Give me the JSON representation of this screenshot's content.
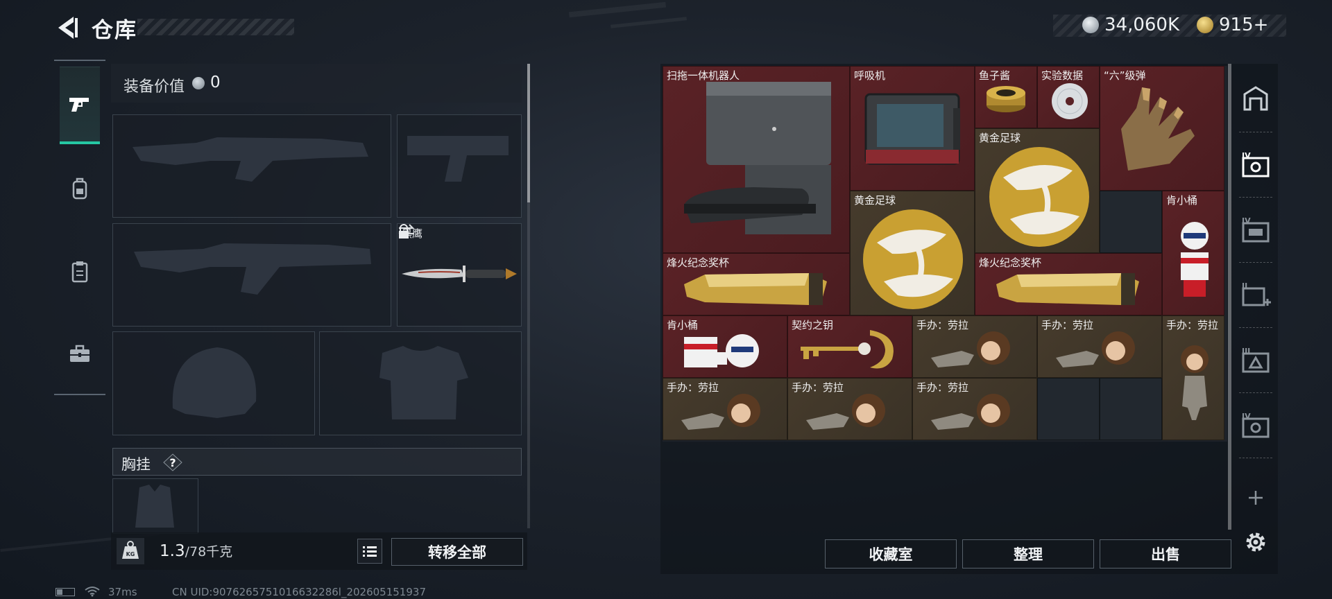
{
  "header": {
    "title": "仓库",
    "back_icon": "back-arrow-icon",
    "currencies": [
      {
        "icon": "silver-coin-icon",
        "value": "34,060K",
        "color": "#c9d0d6"
      },
      {
        "icon": "gold-triangle-coin-icon",
        "value": "915+",
        "color": "#d8b24a"
      }
    ]
  },
  "left_rail": {
    "tabs": [
      {
        "icon": "pistol-icon",
        "active": true
      },
      {
        "icon": "backpack-icon",
        "active": false
      },
      {
        "icon": "clipboard-icon",
        "active": false
      },
      {
        "icon": "toolbox-icon",
        "active": false
      }
    ],
    "accent": "#26c7a3"
  },
  "equipment": {
    "value_label": "装备价值",
    "value": "0",
    "slots": [
      {
        "slot": "primary-weapon-1",
        "item": ""
      },
      {
        "slot": "pistol",
        "item": ""
      },
      {
        "slot": "primary-weapon-2",
        "item": ""
      },
      {
        "slot": "melee",
        "item": "黑鹰",
        "locked": true
      },
      {
        "slot": "helmet",
        "item": ""
      },
      {
        "slot": "armor",
        "item": ""
      }
    ],
    "vest_label": "胸挂",
    "vest_help": "?",
    "weight_current": "1.3",
    "weight_max": "/78千克",
    "weight_icon_label": "KG",
    "transfer_all": "转移全部"
  },
  "storage": {
    "items": [
      {
        "name": "扫拖一体机器人",
        "bg": "red"
      },
      {
        "name": "呼吸机",
        "bg": "red"
      },
      {
        "name": "鱼子酱",
        "bg": "red"
      },
      {
        "name": "实验数据",
        "bg": "red"
      },
      {
        "name": "“六”级弹",
        "bg": "red"
      },
      {
        "name": "黄金足球",
        "bg": "gold"
      },
      {
        "name": "黄金足球",
        "bg": "gold"
      },
      {
        "name": "肯小桶",
        "bg": "red"
      },
      {
        "name": "烽火纪念奖杯",
        "bg": "red"
      },
      {
        "name": "烽火纪念奖杯",
        "bg": "red"
      },
      {
        "name": "肯小桶",
        "bg": "red"
      },
      {
        "name": "契约之钥",
        "bg": "red"
      },
      {
        "name": "手办：劳拉",
        "bg": "gold"
      },
      {
        "name": "手办：劳拉",
        "bg": "gold"
      },
      {
        "name": "手办：劳拉",
        "bg": "gold"
      },
      {
        "name": "手办：劳拉",
        "bg": "gold"
      },
      {
        "name": "手办：劳拉",
        "bg": "gold"
      },
      {
        "name": "手办：劳拉",
        "bg": "gold"
      }
    ],
    "buttons": {
      "collection": "收藏室",
      "organize": "整理",
      "sell": "出售"
    },
    "rarity_colors": {
      "red": "#5a2226",
      "gold": "#463b2c"
    }
  },
  "right_rail": {
    "icons": [
      "vault-icon",
      "container-iv-icon",
      "container-iv-slot-icon",
      "container-ii-add-icon",
      "container-iii-icon",
      "container-iv-secondary-icon",
      "add-icon",
      "gear-icon"
    ]
  },
  "status_bar": {
    "ping": "37ms",
    "uid": "CN UID:9076265751016632286l_202605151937"
  }
}
